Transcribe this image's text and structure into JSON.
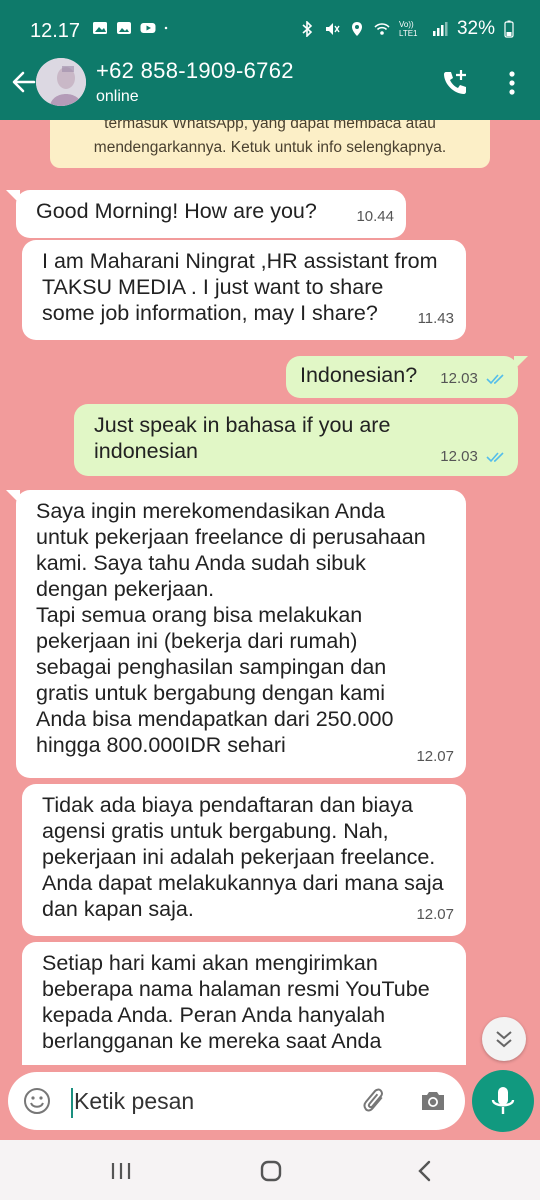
{
  "status_bar": {
    "time": "12.17",
    "battery": "32%",
    "network": "Vo)) LTE1"
  },
  "header": {
    "contact_name": "+62 858-1909-6762",
    "contact_status": "online"
  },
  "system_note": "Siapa pun di luar chat ini, tidak seorang pun di luar chat ini, termasuk WhatsApp, yang dapat membaca atau mendengarkannya. Ketuk untuk info selengkapnya.",
  "system_note_visible": "termasuk WhatsApp, yang dapat membaca atau mendengarkannya. Ketuk untuk info selengkapnya.",
  "messages": [
    {
      "direction": "in",
      "text": "Good Morning! How are you?",
      "time": "10.44"
    },
    {
      "direction": "in",
      "text": "I am Maharani  Ningrat ,HR assistant from TAKSU MEDIA . I just want to share some job information, may I share?",
      "time": "11.43"
    },
    {
      "direction": "out",
      "text": "Indonesian?",
      "time": "12.03",
      "status": "read"
    },
    {
      "direction": "out",
      "text": "Just speak in bahasa if you are indonesian",
      "time": "12.03",
      "status": "read"
    },
    {
      "direction": "in",
      "text": "Saya ingin merekomendasikan Anda untuk pekerjaan freelance di perusahaan kami. Saya tahu Anda sudah sibuk dengan pekerjaan.\nTapi semua orang bisa melakukan pekerjaan ini (bekerja dari rumah) sebagai penghasilan sampingan dan gratis untuk bergabung dengan kami Anda bisa mendapatkan dari 250.000 hingga 800.000IDR sehari",
      "time": "12.07"
    },
    {
      "direction": "in",
      "text": "Tidak ada biaya pendaftaran dan biaya agensi gratis untuk bergabung. Nah, pekerjaan ini adalah pekerjaan freelance. Anda dapat melakukannya dari mana saja dan kapan saja.",
      "time": "12.07"
    },
    {
      "direction": "in",
      "text": "Setiap hari kami akan mengirimkan beberapa nama halaman resmi YouTube kepada Anda. Peran Anda hanyalah berlangganan ke mereka saat Anda",
      "time": ""
    }
  ],
  "input": {
    "placeholder": "Ketik pesan"
  },
  "colors": {
    "header": "#0e7a6a",
    "chat_background": "#f29b9b",
    "outgoing_bubble": "#e1f7c6",
    "incoming_bubble": "#ffffff",
    "mic_button": "#11997f",
    "read_ticks": "#53bdeb"
  },
  "icons": {
    "back": "arrow-left-icon",
    "call": "add-call-icon",
    "menu": "more-vert-icon",
    "emoji": "emoji-icon",
    "attach": "paperclip-icon",
    "camera": "camera-icon",
    "mic": "mic-icon",
    "scroll": "double-chevron-down-icon"
  }
}
